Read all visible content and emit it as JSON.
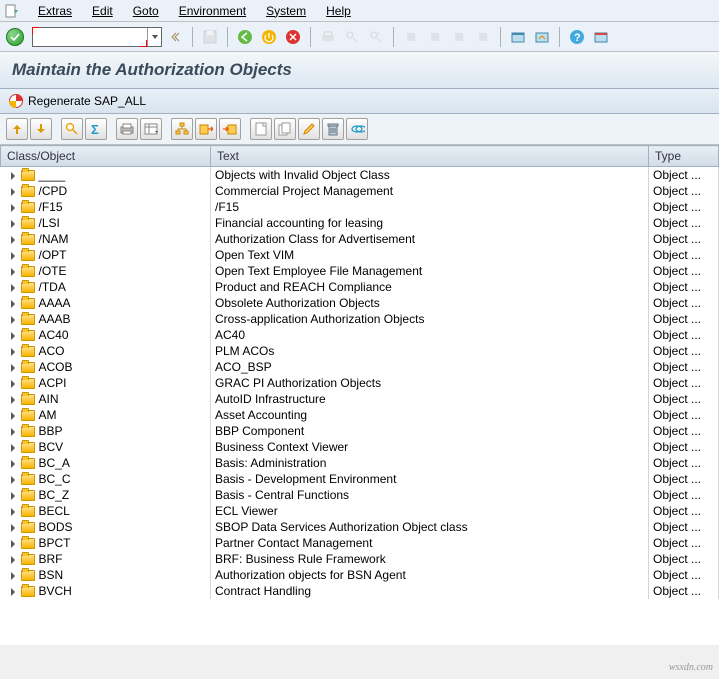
{
  "menu": {
    "items": [
      "Extras",
      "Edit",
      "Goto",
      "Environment",
      "System",
      "Help"
    ]
  },
  "title": "Maintain the Authorization Objects",
  "appfunc": {
    "regenerate": "Regenerate SAP_ALL"
  },
  "table": {
    "headers": {
      "col0": "Class/Object",
      "col1": "Text",
      "col2": "Type"
    },
    "rows": [
      {
        "obj": "____",
        "text": "Objects with Invalid Object Class",
        "type": "Object ..."
      },
      {
        "obj": "/CPD",
        "text": "Commercial Project Management",
        "type": "Object ..."
      },
      {
        "obj": "/F15",
        "text": "/F15",
        "type": "Object ..."
      },
      {
        "obj": "/LSI",
        "text": "Financial accounting for leasing",
        "type": "Object ..."
      },
      {
        "obj": "/NAM",
        "text": "Authorization Class for Advertisement",
        "type": "Object ..."
      },
      {
        "obj": "/OPT",
        "text": "Open Text VIM",
        "type": "Object ..."
      },
      {
        "obj": "/OTE",
        "text": "Open Text Employee File Management",
        "type": "Object ..."
      },
      {
        "obj": "/TDA",
        "text": "Product and REACH Compliance",
        "type": "Object ..."
      },
      {
        "obj": "AAAA",
        "text": "Obsolete Authorization Objects",
        "type": "Object ..."
      },
      {
        "obj": "AAAB",
        "text": "Cross-application Authorization Objects",
        "type": "Object ..."
      },
      {
        "obj": "AC40",
        "text": "AC40",
        "type": "Object ..."
      },
      {
        "obj": "ACO",
        "text": "PLM ACOs",
        "type": "Object ..."
      },
      {
        "obj": "ACOB",
        "text": "ACO_BSP",
        "type": "Object ..."
      },
      {
        "obj": "ACPI",
        "text": "GRAC PI Authorization Objects",
        "type": "Object ..."
      },
      {
        "obj": "AIN",
        "text": "AutoID Infrastructure",
        "type": "Object ..."
      },
      {
        "obj": "AM",
        "text": "Asset Accounting",
        "type": "Object ..."
      },
      {
        "obj": "BBP",
        "text": "BBP Component",
        "type": "Object ..."
      },
      {
        "obj": "BCV",
        "text": "Business Context Viewer",
        "type": "Object ..."
      },
      {
        "obj": "BC_A",
        "text": "Basis: Administration",
        "type": "Object ..."
      },
      {
        "obj": "BC_C",
        "text": "Basis - Development Environment",
        "type": "Object ..."
      },
      {
        "obj": "BC_Z",
        "text": "Basis - Central Functions",
        "type": "Object ..."
      },
      {
        "obj": "BECL",
        "text": "ECL Viewer",
        "type": "Object ..."
      },
      {
        "obj": "BODS",
        "text": "SBOP Data Services Authorization Object class",
        "type": "Object ..."
      },
      {
        "obj": "BPCT",
        "text": "Partner Contact Management",
        "type": "Object ..."
      },
      {
        "obj": "BRF",
        "text": "BRF: Business Rule Framework",
        "type": "Object ..."
      },
      {
        "obj": "BSN",
        "text": "Authorization objects for BSN Agent",
        "type": "Object ..."
      },
      {
        "obj": "BVCH",
        "text": "Contract Handling",
        "type": "Object ..."
      }
    ]
  },
  "watermark": "wsxdn.com"
}
